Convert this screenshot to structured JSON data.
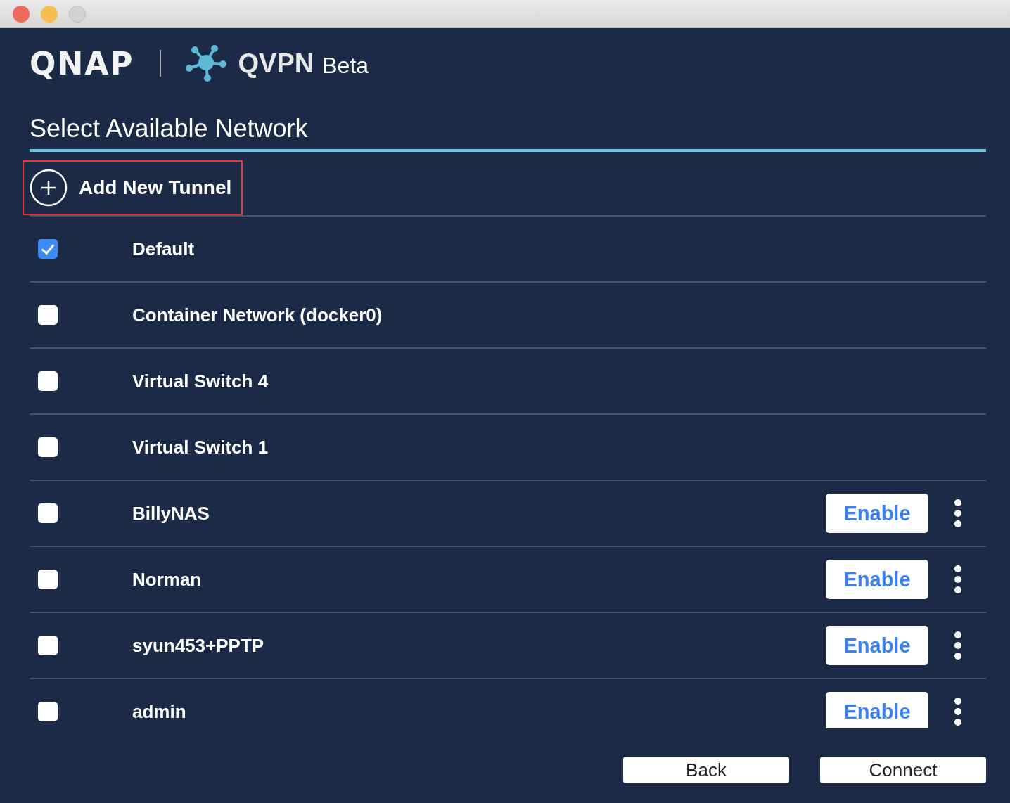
{
  "header": {
    "brand": "QNAP",
    "app_name": "QVPN",
    "app_tag": "Beta"
  },
  "heading": "Select Available Network",
  "add_tunnel": {
    "label": "Add New Tunnel"
  },
  "networks": [
    {
      "name": "Default",
      "checked": true,
      "kind": "plain"
    },
    {
      "name": "Container Network (docker0)",
      "checked": false,
      "kind": "plain"
    },
    {
      "name": "Virtual Switch 4",
      "checked": false,
      "kind": "plain"
    },
    {
      "name": "Virtual Switch 1",
      "checked": false,
      "kind": "plain"
    },
    {
      "name": "BillyNAS",
      "checked": false,
      "kind": "tunnel",
      "action": "Enable"
    },
    {
      "name": "Norman",
      "checked": false,
      "kind": "tunnel",
      "action": "Enable"
    },
    {
      "name": "syun453+PPTP",
      "checked": false,
      "kind": "tunnel",
      "action": "Enable"
    },
    {
      "name": "admin",
      "checked": false,
      "kind": "tunnel",
      "action": "Enable"
    }
  ],
  "buttons": [
    "Back",
    "Connect"
  ]
}
